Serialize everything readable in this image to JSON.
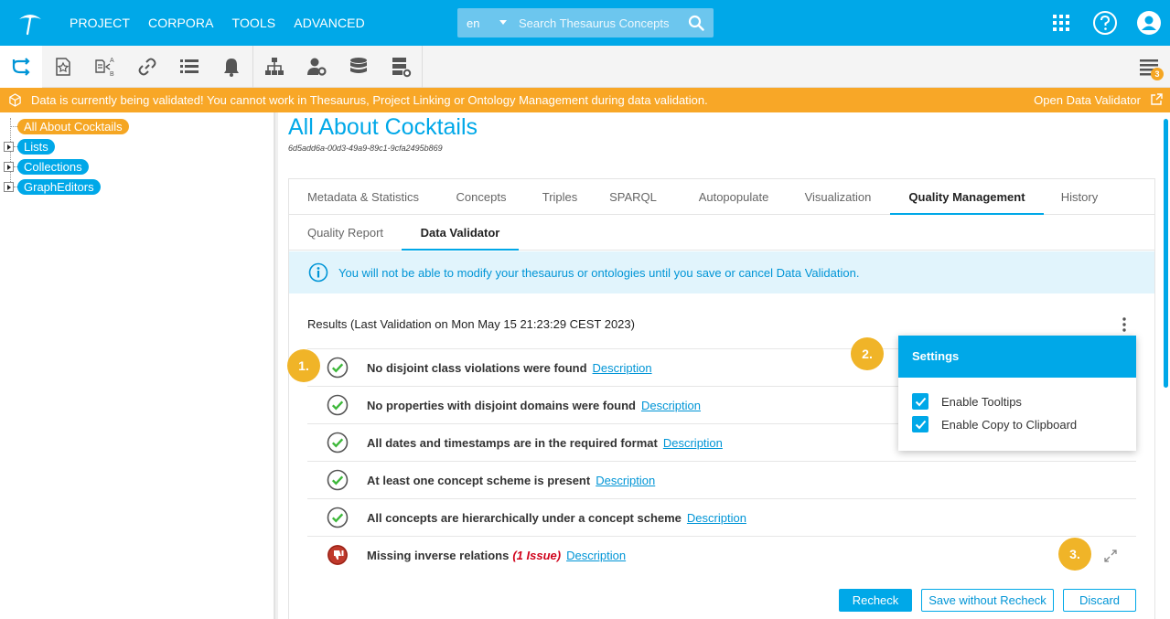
{
  "topbar": {
    "nav": [
      "PROJECT",
      "CORPORA",
      "TOOLS",
      "ADVANCED"
    ],
    "search": {
      "language": "en",
      "placeholder": "Search Thesaurus Concepts"
    },
    "icons": [
      "apps-grid-icon",
      "help-icon",
      "user-account-icon"
    ]
  },
  "toolbar": {
    "icons": [
      "thesaurus-tree-icon",
      "favorites-icon",
      "translation-icon",
      "linking-icon",
      "list-icon",
      "notifications-icon",
      "hierarchy-icon",
      "user-settings-icon",
      "database-icon",
      "server-settings-icon"
    ],
    "notification_count": "3"
  },
  "warning": {
    "text": "Data is currently being validated! You cannot work in Thesaurus, Project Linking or Ontology Management during data validation.",
    "link": "Open Data Validator"
  },
  "tree": {
    "root": "All About Cocktails",
    "children": [
      "Lists",
      "Collections",
      "GraphEditors"
    ]
  },
  "page": {
    "title": "All About Cocktails",
    "uuid": "6d5add6a-00d3-49a9-89c1-9cfa2495b869"
  },
  "tabs": [
    "Metadata & Statistics",
    "Concepts",
    "Triples",
    "SPARQL",
    "Autopopulate",
    "Visualization",
    "Quality Management",
    "History"
  ],
  "active_tab": "Quality Management",
  "subtabs": [
    "Quality Report",
    "Data Validator"
  ],
  "active_subtab": "Data Validator",
  "info_text": "You will not be able to modify your thesaurus or ontologies until you save or cancel Data Validation.",
  "results": {
    "label": "Results",
    "last_validation": "(Last Validation on Mon May 15 21:23:29 CEST 2023)",
    "rows": [
      {
        "status": "ok",
        "text": "No disjoint class violations were found",
        "issue": "",
        "link": "Description"
      },
      {
        "status": "ok",
        "text": "No properties with disjoint domains were found",
        "issue": "",
        "link": "Description"
      },
      {
        "status": "ok",
        "text": "All dates and timestamps are in the required format",
        "issue": "",
        "link": "Description"
      },
      {
        "status": "ok",
        "text": "At least one concept scheme is present",
        "issue": "",
        "link": "Description"
      },
      {
        "status": "ok",
        "text": "All concepts are hierarchically under a concept scheme",
        "issue": "",
        "link": "Description"
      },
      {
        "status": "fail",
        "text": "Missing inverse relations",
        "issue": "(1 Issue)",
        "link": "Description"
      }
    ]
  },
  "step_badges": [
    "1.",
    "2.",
    "3."
  ],
  "settings": {
    "title": "Settings",
    "options": [
      {
        "label": "Enable Tooltips",
        "checked": true
      },
      {
        "label": "Enable Copy to Clipboard",
        "checked": true
      }
    ]
  },
  "buttons": {
    "recheck": "Recheck",
    "save_without_recheck": "Save without Recheck",
    "discard": "Discard"
  },
  "colors": {
    "brand": "#00a8e8",
    "warning": "#f8a727",
    "badge": "#f0b428",
    "ok": "#3db83a",
    "fail": "#c0392b"
  }
}
